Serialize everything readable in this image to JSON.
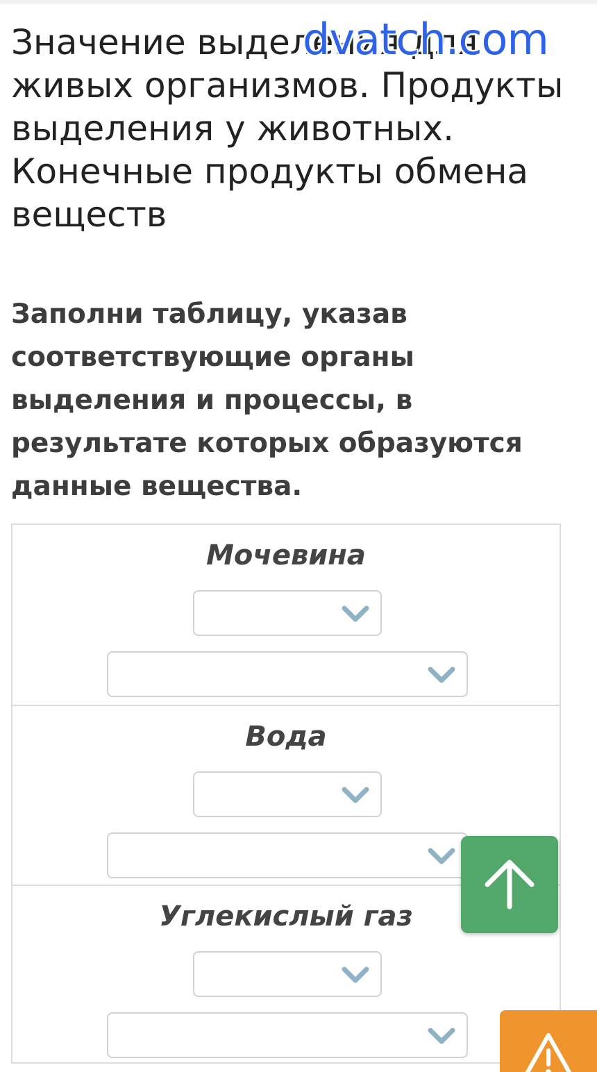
{
  "header": {
    "title": "Значение выделения для живых организмов. Продукты выделения у животных. Конечные продукты обмена веществ",
    "watermark": "dvatch.com"
  },
  "task": {
    "instruction": "Заполни таблицу, указав соответствующие органы выделения и процессы, в результате которых образуются данные вещества.",
    "rows": [
      {
        "label": "Мочевина",
        "organ_select": "",
        "process_select": ""
      },
      {
        "label": "Вода",
        "organ_select": "",
        "process_select": ""
      },
      {
        "label": "Углекислый газ",
        "organ_select": "",
        "process_select": ""
      }
    ]
  },
  "icons": {
    "chevron": "chevron-down-icon",
    "scroll_up": "arrow-up-icon",
    "report": "warning-icon"
  },
  "colors": {
    "scroll_up_bg": "#52a86a",
    "report_bg": "#f0952d",
    "chevron": "#8fb3c4",
    "border": "#dcdcdc"
  }
}
